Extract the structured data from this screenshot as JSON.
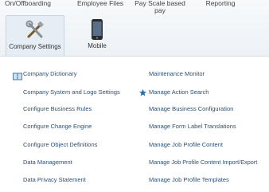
{
  "top_tabs": [
    "On/Offboarding",
    "Employee Files",
    "Pay Scale based pay",
    "Reporting"
  ],
  "icon_tabs": {
    "company_settings": {
      "label": "Company Settings",
      "icon": "tools-icon"
    },
    "mobile": {
      "label": "Mobile",
      "icon": "mobile-phone-icon"
    }
  },
  "links_col1": [
    "Company Dictionary",
    "Company System and Logo Settings",
    "Configure Business Rules",
    "Configure Change Engine",
    "Configure Object Definitions",
    "Data Management",
    "Data Privacy Statement"
  ],
  "links_col2": [
    "Maintenance Monitor",
    "Manage Action Search",
    "Manage Business Configuration",
    "Manage Form Label Translations",
    "Manage Job Profile Content",
    "Manage Job Profile Content Import/Export",
    "Manage Job Profile Templates"
  ],
  "colors": {
    "link": "#2f4f6f",
    "star": "#1e72b8",
    "active_tab": "#e6edf4"
  }
}
